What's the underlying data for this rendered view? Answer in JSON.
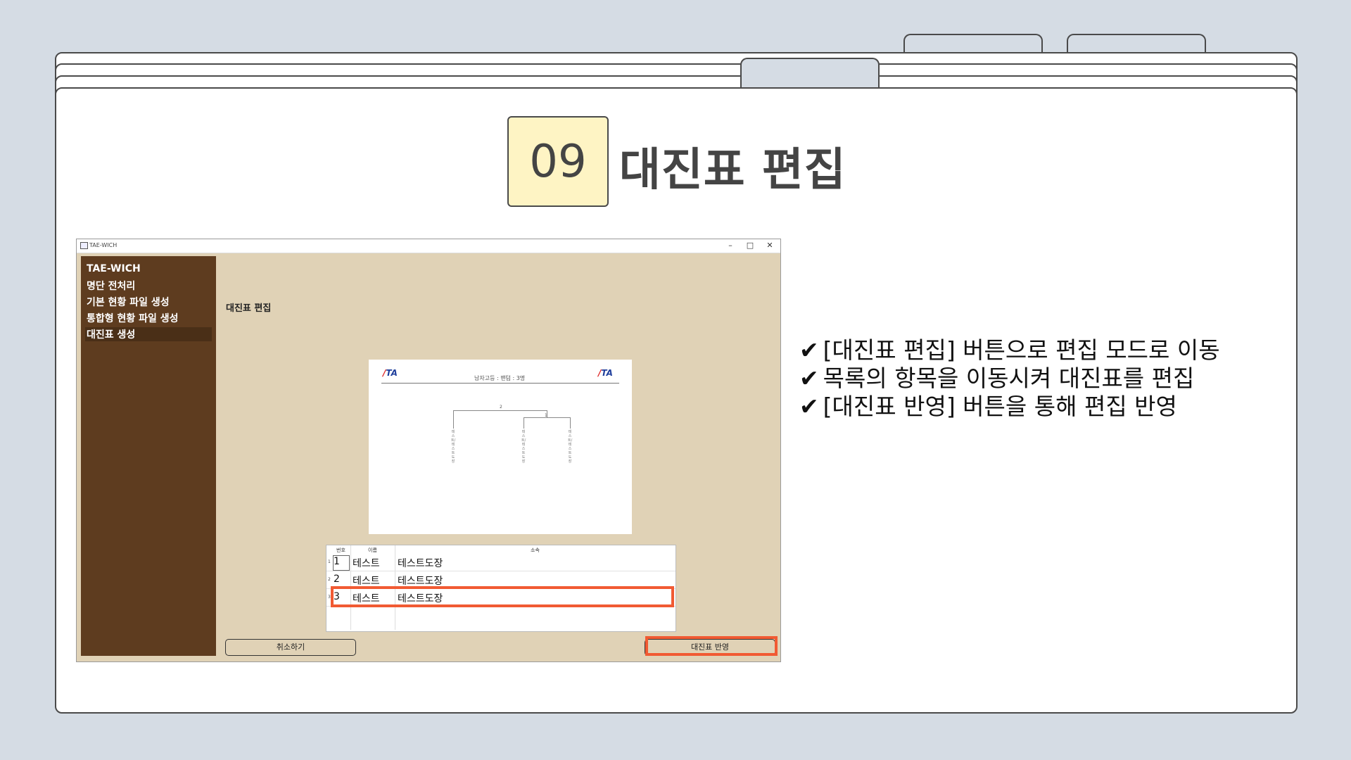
{
  "slide": {
    "step_number": "09",
    "step_title": "대진표 편집"
  },
  "app_window": {
    "title": "TAE-WICH",
    "controls": {
      "minimize": "–",
      "maximize": "□",
      "close": "✕"
    },
    "sidebar": {
      "items": [
        {
          "label": "TAE-WICH"
        },
        {
          "label": "명단 전처리"
        },
        {
          "label": "기본 현황 파일 생성"
        },
        {
          "label": "통합형 현황 파일 생성"
        },
        {
          "label": "대진표 생성",
          "active": true
        }
      ]
    },
    "page_heading": "대진표 편집",
    "bracket_preview": {
      "header_text": "남자고등 : 밴텀 : 3명",
      "logo_left": "TA",
      "logo_right": "TA",
      "match_numbers": [
        "2",
        "1"
      ],
      "vertical_names": [
        "테스트/테스트도장",
        "테스트/테스트도장",
        "테스트/테스트도장"
      ]
    },
    "entry_table": {
      "columns": [
        "번호",
        "이름",
        "소속"
      ],
      "rows": [
        {
          "index": "1",
          "no": "1",
          "name": "테스트",
          "affiliation": "테스트도장"
        },
        {
          "index": "2",
          "no": "2",
          "name": "테스트",
          "affiliation": "테스트도장"
        },
        {
          "index": "3",
          "no": "3",
          "name": "테스트",
          "affiliation": "테스트도장"
        }
      ]
    },
    "buttons": {
      "cancel": "취소하기",
      "apply": "대진표 반영"
    }
  },
  "highlight_color": "#f15a33",
  "instructions": [
    "[대진표 편집] 버튼으로 편집 모드로 이동",
    "목록의 항목을 이동시켜 대진표를 편집",
    "[대진표 반영] 버튼을 통해 편집 반영"
  ],
  "check_mark": "✔"
}
